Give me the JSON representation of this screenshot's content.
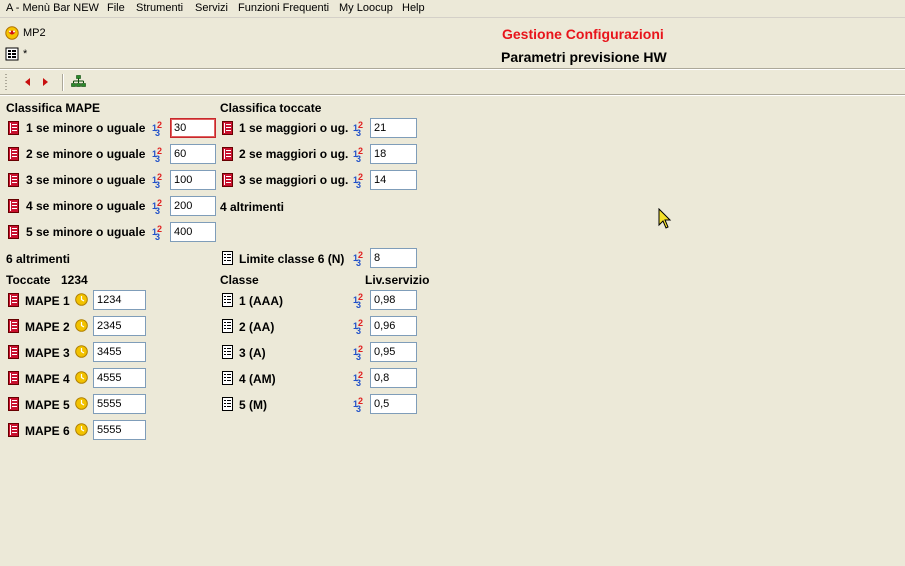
{
  "menu": [
    "A - Menù Bar NEW",
    "File",
    "Strumenti",
    "Servizi",
    "Funzioni Frequenti",
    "My Loocup",
    "Help"
  ],
  "header": {
    "app_code": "MP2",
    "doc_marker": "*",
    "title": "Gestione Configurazioni",
    "subtitle": "Parametri previsione HW"
  },
  "colors": {
    "title": "#e8141b",
    "background": "#ece9d8",
    "book_icon": "#c8102e",
    "field_border": "#7f9db9"
  },
  "mape": {
    "section_label": "Classifica MAPE",
    "rows": [
      {
        "label": "1 se minore o uguale",
        "value": "30"
      },
      {
        "label": "2 se minore o uguale",
        "value": "60"
      },
      {
        "label": "3 se minore o uguale",
        "value": "100"
      },
      {
        "label": "4 se minore o uguale",
        "value": "200"
      },
      {
        "label": "5 se minore o uguale",
        "value": "400"
      }
    ],
    "otherwise": "6 altrimenti"
  },
  "toccate": {
    "section_label": "Classifica toccate",
    "rows": [
      {
        "label": "1 se maggiori o ug.",
        "value": "21"
      },
      {
        "label": "2 se maggiori o ug.",
        "value": "18"
      },
      {
        "label": "3 se maggiori o ug.",
        "value": "14"
      }
    ],
    "otherwise": "4 altrimenti"
  },
  "limite": {
    "label": "Limite classe 6 (N)",
    "value": "8"
  },
  "toccate_list": {
    "header_label": "Toccate",
    "header_value": "1234",
    "rows": [
      {
        "label": "MAPE 1",
        "value": "1234"
      },
      {
        "label": "MAPE 2",
        "value": "2345"
      },
      {
        "label": "MAPE 3",
        "value": "3455"
      },
      {
        "label": "MAPE 4",
        "value": "4555"
      },
      {
        "label": "MAPE 5",
        "value": "5555"
      },
      {
        "label": "MAPE 6",
        "value": "5555"
      }
    ]
  },
  "classi": {
    "header_label": "Classe",
    "service_label": "Liv.servizio",
    "rows": [
      {
        "label": "1 (AAA)",
        "value": "0,98"
      },
      {
        "label": "2 (AA)",
        "value": "0,96"
      },
      {
        "label": "3 (A)",
        "value": "0,95"
      },
      {
        "label": "4 (AM)",
        "value": "0,8"
      },
      {
        "label": "5 (M)",
        "value": "0,5"
      }
    ]
  },
  "icons": {
    "book": "red-book-icon",
    "number": "number-format-icon",
    "clock": "clock-icon",
    "doc": "document-list-icon",
    "prev": "arrow-left-icon",
    "next": "arrow-right-icon",
    "tree": "hierarchy-icon"
  }
}
